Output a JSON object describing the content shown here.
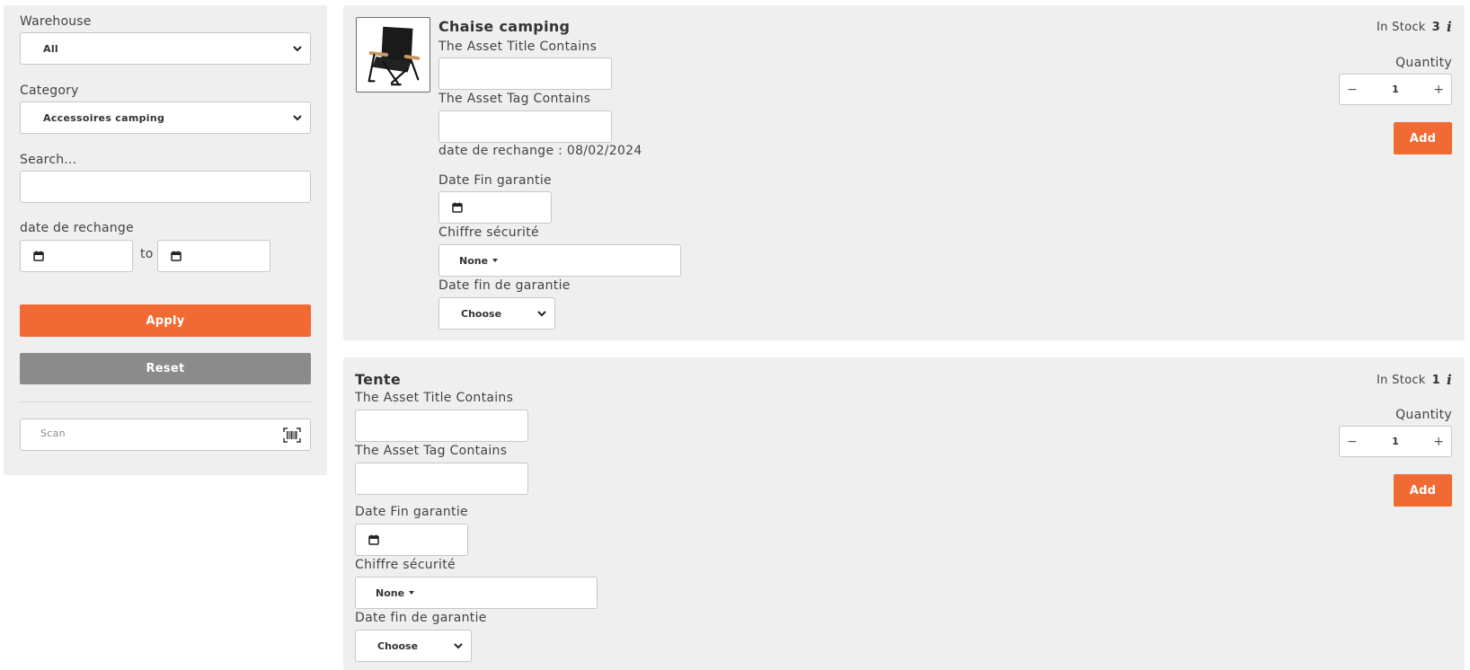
{
  "filters": {
    "warehouse_label": "Warehouse",
    "warehouse_value": "All",
    "category_label": "Category",
    "category_value": "Accessoires camping",
    "search_label": "Search...",
    "search_value": "",
    "date_label": "date de rechange",
    "date_to": "to",
    "apply_label": "Apply",
    "reset_label": "Reset",
    "scan_placeholder": "Scan"
  },
  "products": [
    {
      "title": "Chaise camping",
      "stock_label": "In Stock",
      "stock_count": "3",
      "quantity_label": "Quantity",
      "quantity": "1",
      "add_label": "Add",
      "asset_title_label": "The Asset Title Contains",
      "asset_tag_label": "The Asset Tag Contains",
      "date_rechange_text": "date de rechange : 08/02/2024",
      "date_fin_garantie_label": "Date Fin garantie",
      "chiffre_securite_label": "Chiffre sécurité",
      "chiffre_securite_value": "None",
      "date_fin_de_garantie_label": "Date fin de garantie",
      "date_fin_de_garantie_value": "Choose"
    },
    {
      "title": "Tente",
      "stock_label": "In Stock",
      "stock_count": "1",
      "quantity_label": "Quantity",
      "quantity": "1",
      "add_label": "Add",
      "asset_title_label": "The Asset Title Contains",
      "asset_tag_label": "The Asset Tag Contains",
      "date_fin_garantie_label": "Date Fin garantie",
      "chiffre_securite_label": "Chiffre sécurité",
      "chiffre_securite_value": "None",
      "date_fin_de_garantie_label": "Date fin de garantie",
      "date_fin_de_garantie_value": "Choose"
    }
  ],
  "colors": {
    "accent": "#f26a33",
    "reset": "#8b8b8b",
    "panel": "#efefef"
  },
  "icons": {
    "chevron": "chevron-down-icon",
    "calendar": "calendar-icon",
    "barcode": "barcode-icon",
    "info": "info-icon",
    "minus": "minus-icon",
    "plus": "plus-icon",
    "product_image": "camping-chair-image"
  }
}
